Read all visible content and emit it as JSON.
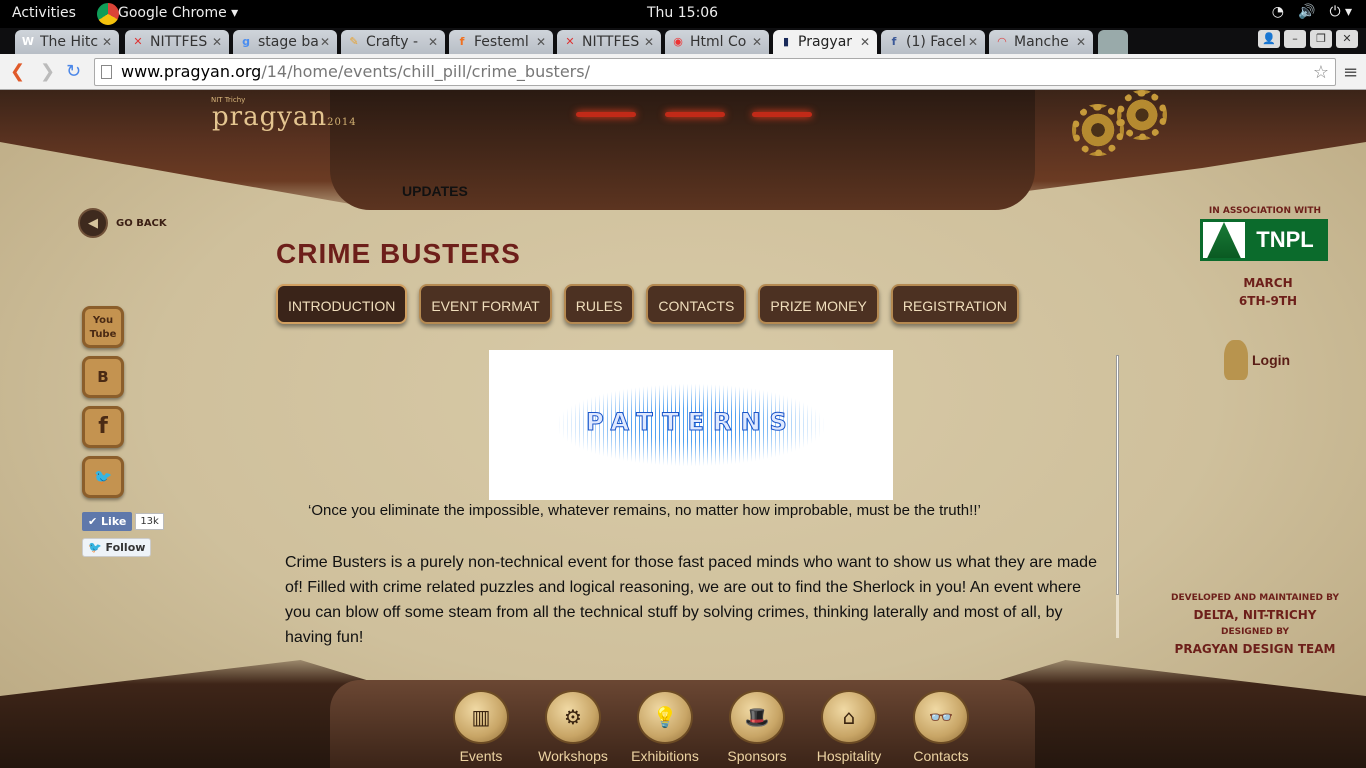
{
  "topbar": {
    "activities": "Activities",
    "app": "Google Chrome ▾",
    "clock": "Thu 15:06",
    "sys": [
      "wifi",
      "vol",
      "power"
    ]
  },
  "tabs": [
    {
      "fav": "W",
      "title": "The Hitc",
      "favColor": "#fff"
    },
    {
      "fav": "✕",
      "title": "NITTFES",
      "favColor": "#d33"
    },
    {
      "fav": "g",
      "title": "stage ba",
      "favColor": "#4a8df0"
    },
    {
      "fav": "✎",
      "title": "Crafty -",
      "favColor": "#e9a22c"
    },
    {
      "fav": "f",
      "title": "Festeml",
      "favColor": "#f07020"
    },
    {
      "fav": "✕",
      "title": "NITTFES",
      "favColor": "#d33"
    },
    {
      "fav": "◉",
      "title": "Html Co",
      "favColor": "#e33"
    },
    {
      "fav": "▮",
      "title": "Pragyar",
      "favColor": "#1a2a5a"
    },
    {
      "fav": "f",
      "title": "(1) Facel",
      "favColor": "#3b5998"
    },
    {
      "fav": "◠",
      "title": "Manche",
      "favColor": "#d44"
    }
  ],
  "url": {
    "domain": "www.pragyan.org",
    "path": "/14/home/events/chill_pill/crime_busters/"
  },
  "page": {
    "logo_small": "NIT Trichy",
    "logo": "pragyan",
    "logo_year": "2014",
    "updates": "UPDATES",
    "go_back": "GO BACK",
    "title": "CRIME BUSTERS",
    "tabs": [
      "INTRODUCTION",
      "EVENT FORMAT",
      "RULES",
      "CONTACTS",
      "PRIZE MONEY",
      "REGISTRATION"
    ],
    "banner": "PATTERNS",
    "quote": "‘Once you eliminate the impossible, whatever remains, no matter how improbable, must be the truth!!’",
    "description": "Crime Busters is a purely non-technical event for those fast paced minds who want to show us what they are made of! Filled with crime related puzzles and logical reasoning, we are out to find the Sherlock in you! An event where you can blow off some steam from all the technical stuff by solving crimes, thinking laterally and most of all, by  having fun!",
    "social": [
      "You Tube",
      "B",
      "f",
      "🐦"
    ],
    "like": "Like",
    "like_count": "13k",
    "follow": "Follow",
    "assoc": "IN ASSOCIATION WITH",
    "sponsor": "TNPL",
    "dates_1": "MARCH",
    "dates_2": "6TH-9TH",
    "login": "Login",
    "credits": {
      "dev": "DEVELOPED AND MAINTAINED BY",
      "delta": "DELTA, NIT-TRICHY",
      "designed": "DESIGNED BY",
      "team": "PRAGYAN DESIGN TEAM"
    },
    "dock": [
      {
        "label": "Events",
        "icon": "▥"
      },
      {
        "label": "Workshops",
        "icon": "⚙"
      },
      {
        "label": "Exhibitions",
        "icon": "💡"
      },
      {
        "label": "Sponsors",
        "icon": "🎩"
      },
      {
        "label": "Hospitality",
        "icon": "⌂"
      },
      {
        "label": "Contacts",
        "icon": "👓"
      }
    ]
  }
}
